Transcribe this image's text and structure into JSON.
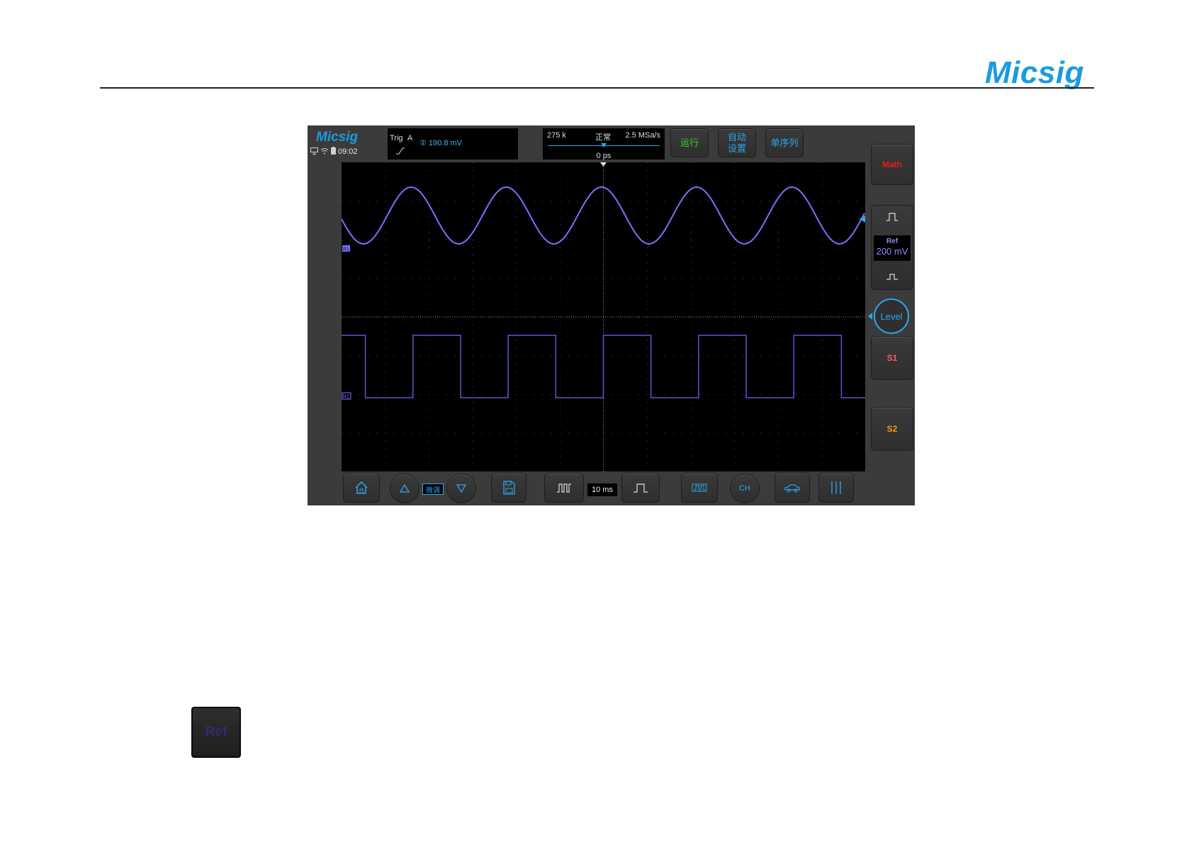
{
  "page": {
    "brand": "Micsig"
  },
  "scope": {
    "brand": "Micsig",
    "status": {
      "time": "09:02"
    },
    "trigger": {
      "label": "Trig",
      "source": "A",
      "level": "② 190.8  mV"
    },
    "timebase": {
      "memory": "275 k",
      "mode": "正常",
      "sample_rate": "2.5 MSa/s",
      "position": "0 ps"
    },
    "top_buttons": {
      "run": "运行",
      "auto_setup": "自动\n设置",
      "single": "单序列"
    },
    "side_buttons": {
      "math": "Math",
      "ref_label": "Ref",
      "ref_scale": "200 mV",
      "level": "Level",
      "s1": "S1",
      "s2": "S2"
    },
    "bottom": {
      "fine": "微调",
      "time_per_div": "10 ms",
      "channel_label": "CH"
    },
    "markers": {
      "r1": "R1",
      "r2": "R2"
    },
    "colors": {
      "accent": "#2aa7ef",
      "run": "#3ed12f",
      "math": "#e81b1b",
      "s1": "#ff5a6e",
      "s2": "#f29d1f",
      "ref_trace": "#7a70ff",
      "ref_trace2": "#5c55d8"
    },
    "waveforms": {
      "ref1": {
        "type": "sine",
        "cycles_visible": 5.5
      },
      "ref2": {
        "type": "square",
        "cycles_visible": 5.5
      }
    }
  },
  "ref_button_large": {
    "label": "Ref"
  }
}
